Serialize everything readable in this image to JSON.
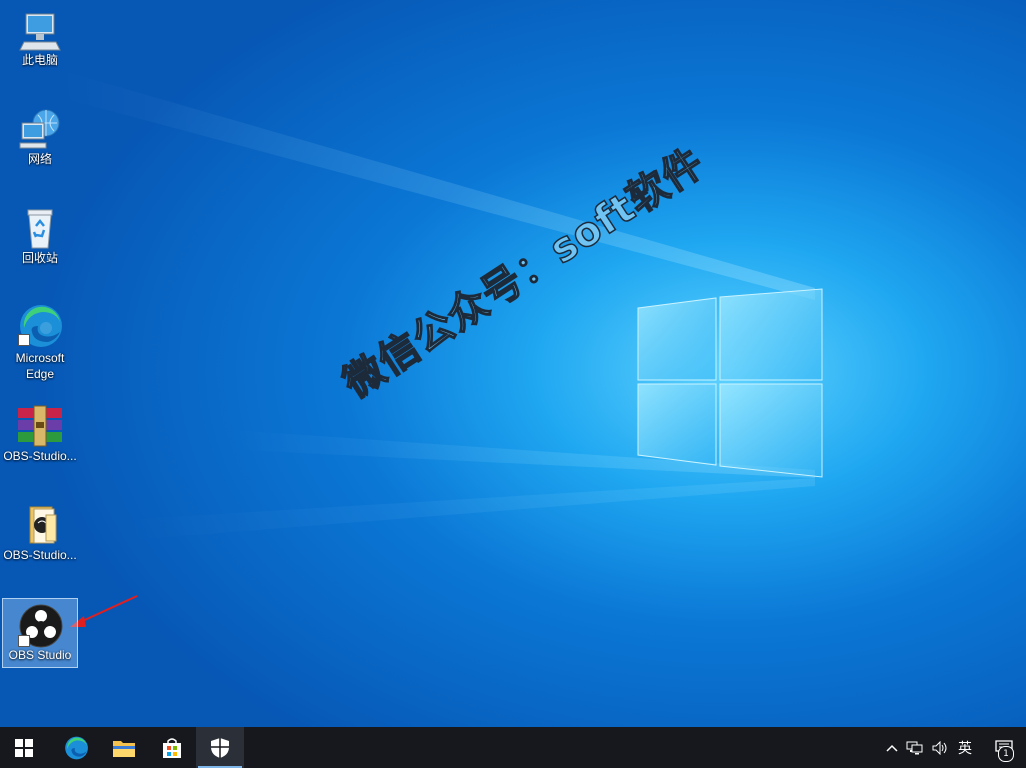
{
  "desktop": {
    "icons": [
      {
        "id": "this-pc",
        "label": "此电脑",
        "icon": "computer-icon"
      },
      {
        "id": "network",
        "label": "网络",
        "icon": "network-icon"
      },
      {
        "id": "recycle-bin",
        "label": "回收站",
        "icon": "recycle-bin-icon"
      },
      {
        "id": "edge",
        "label": "Microsoft Edge",
        "icon": "edge-icon"
      },
      {
        "id": "obs-archive",
        "label": "OBS-Studio...",
        "icon": "winrar-archive-icon"
      },
      {
        "id": "obs-folder",
        "label": "OBS-Studio...",
        "icon": "folder-icon"
      },
      {
        "id": "obs-studio",
        "label": "OBS Studio",
        "icon": "obs-studio-icon",
        "selected": true
      }
    ],
    "watermark": "微信公众号：soft软件"
  },
  "taskbar": {
    "buttons": [
      {
        "id": "start",
        "icon": "windows-start-icon"
      },
      {
        "id": "edge",
        "icon": "edge-icon"
      },
      {
        "id": "file-explorer",
        "icon": "folder-icon"
      },
      {
        "id": "store",
        "icon": "store-icon"
      },
      {
        "id": "security",
        "icon": "shield-icon",
        "active": true
      }
    ],
    "tray": {
      "chevron_icon": "chevron-up-icon",
      "network_icon": "network-icon",
      "volume_icon": "volume-icon",
      "ime_label": "英",
      "notification_count": "1"
    }
  },
  "colors": {
    "accent": "#0b78d6",
    "taskbar": "#16181d",
    "annotation_arrow": "#e02020"
  }
}
